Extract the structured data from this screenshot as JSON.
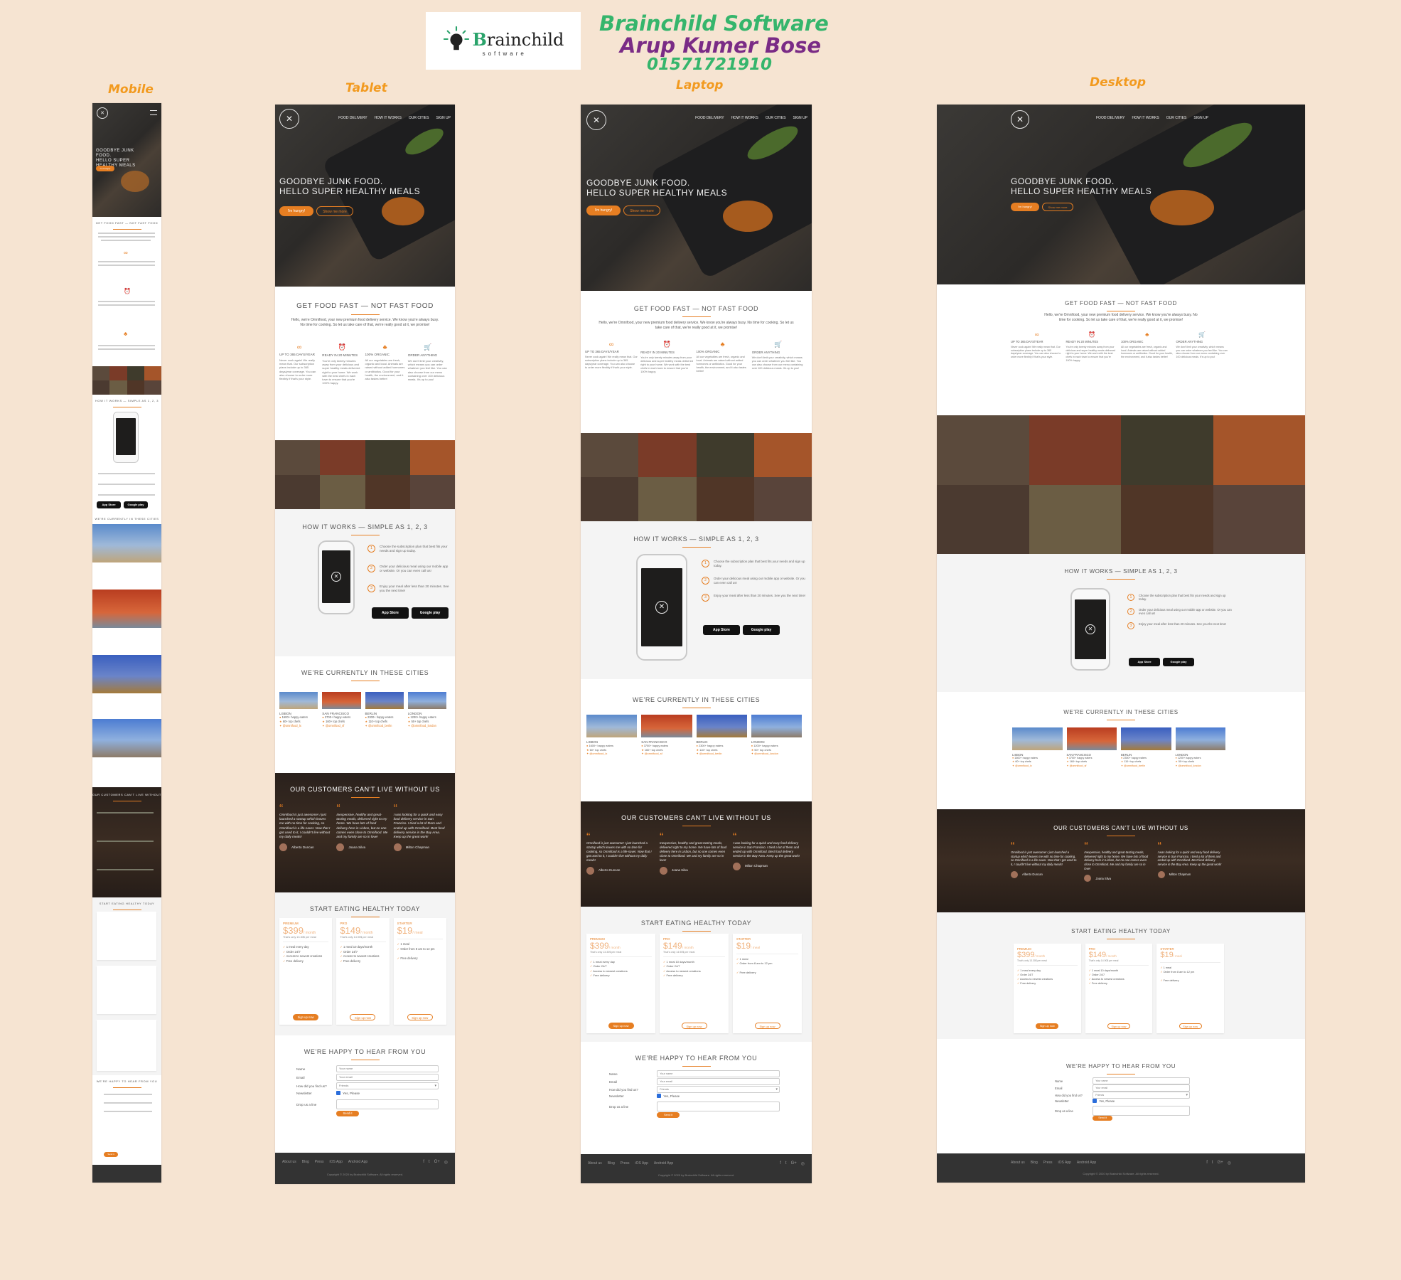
{
  "brand": {
    "logo_word_a": "B",
    "logo_word_b": "rainchild",
    "logo_sub": "software",
    "company": "Brainchild Software",
    "person": "Arup Kumer Bose",
    "phone": "01571721910"
  },
  "labels": {
    "mobile": "Mobile",
    "tablet": "Tablet",
    "laptop": "Laptop",
    "desktop": "Desktop"
  },
  "colors": {
    "accent": "#e67e22",
    "background": "#f6e4d2",
    "brand_green": "#35b56c",
    "brand_purple": "#7a2b86"
  },
  "site": {
    "nav": [
      "Food Delivery",
      "How it works",
      "Our cities",
      "Sign up"
    ],
    "hero_line1": "Goodbye junk food.",
    "hero_line2": "Hello super healthy meals",
    "btn_hungry": "I'm hungry!",
    "btn_more": "Show me more",
    "features_title": "Get food fast — not fast food",
    "features_intro": "Hello, we're Omnifood, your new premium food delivery service. We know you're always busy. No time for cooking. So let us take care of that, we're really good at it, we promise!",
    "features": [
      {
        "icon": "infinity-icon",
        "glyph": "∞",
        "title": "Up to 365 days/year",
        "text": "Never cook again! We really mean that. Our subscription plans include up to 365 days/year coverage. You can also choose to order more flexibly if that's your style."
      },
      {
        "icon": "alarm-icon",
        "glyph": "⏰",
        "title": "Ready in 20 minutes",
        "text": "You're only twenty minutes away from your delicious and super healthy meals delivered right to your home. We work with the best chefs in each town to ensure that you're 100% happy."
      },
      {
        "icon": "carrot-icon",
        "glyph": "♣",
        "title": "100% organic",
        "text": "All our vegetables are fresh, organic and local. Animals are raised without added hormones or antibiotics. Good for your health, the environment, and it also tastes better!"
      },
      {
        "icon": "cart-icon",
        "glyph": "🛒",
        "title": "Order anything",
        "text": "We don't limit your creativity, which means you can order whatever you feel like. You can also choose from our menu containing over 100 delicious meals. It's up to you!"
      }
    ],
    "works_title": "How it works — Simple as 1, 2, 3",
    "steps": [
      {
        "num": "1",
        "text": "Choose the subscription plan that best fits your needs and sign up today."
      },
      {
        "num": "2",
        "text": "Order your delicious meal using our mobile app or website. Or you can even call us!"
      },
      {
        "num": "3",
        "text": "Enjoy your meal after less than 20 minutes. See you the next time!"
      }
    ],
    "app_store": "App Store",
    "google_play": "Google play",
    "cities_title": "We're currently in these cities",
    "cities": [
      {
        "name": "Lisbon",
        "eaters": "1600+ happy eaters",
        "chefs": "60+ top chefs",
        "handle": "@omnifood_lx"
      },
      {
        "name": "San Francisco",
        "eaters": "3700+ happy eaters",
        "chefs": "160+ top chefs",
        "handle": "@omnifood_sf"
      },
      {
        "name": "Berlin",
        "eaters": "2300+ happy eaters",
        "chefs": "110+ top chefs",
        "handle": "@omnifood_berlin"
      },
      {
        "name": "London",
        "eaters": "1200+ happy eaters",
        "chefs": "50+ top chefs",
        "handle": "@omnifood_london"
      }
    ],
    "testimonials_title": "Our customers can't live without us",
    "testimonials": [
      {
        "text": "Omnifood is just awesome! I just launched a startup which leaves me with no time for cooking, so Omnifood is a life-saver. Now that I got used to it, I couldn't live without my daily meals!",
        "name": "Alberto Duncan"
      },
      {
        "text": "Inexpensive, healthy and great-tasting meals, delivered right to my home. We have lots of food delivery here in Lisbon, but no one comes even close to Omnifood. Me and my family are so in love!",
        "name": "Joana Silva"
      },
      {
        "text": "I was looking for a quick and easy food delivery service in San Franciso. I tried a lot of them and ended up with Omnifood. Best food delivery service in the Bay Area. Keep up the great work!",
        "name": "Milton Chapman"
      }
    ],
    "plans_title": "Start eating healthy today",
    "plans": [
      {
        "name": "Premium",
        "price": "$399",
        "per": "/ month",
        "note": "That's only 13.30$ per meal",
        "items": [
          "1 meal every day",
          "Order 24/7",
          "Access to newest creations",
          "Free delivery"
        ],
        "button": "Sign up now"
      },
      {
        "name": "Pro",
        "price": "$149",
        "per": "/ month",
        "note": "That's only 14.90$ per meal",
        "items": [
          "1 meal 10 days/month",
          "Order 24/7",
          "Access to newest creations",
          "Free delivery"
        ],
        "button": "Sign up now"
      },
      {
        "name": "Starter",
        "price": "$19",
        "per": "/ meal",
        "note": "",
        "items": [
          "1 meal",
          "Order from 8 am to 12 pm",
          "",
          "Free delivery"
        ],
        "button": "Sign up now"
      }
    ],
    "form_title": "We're happy to hear from you",
    "form": {
      "name_label": "Name",
      "name_placeholder": "Your name",
      "email_label": "Email",
      "email_placeholder": "Your email",
      "find_label": "How did you find us?",
      "find_value": "Friends",
      "newsletter_label": "Newsletter",
      "newsletter_value": "Yes, Please",
      "message_label": "Drop us a line",
      "submit": "Send it"
    },
    "footer_links": [
      "About us",
      "Blog",
      "Press",
      "iOS App",
      "Android App"
    ],
    "footer_social": [
      "f",
      "t",
      "G+",
      "◎"
    ],
    "copyright": "Copyright © 2020 by Brainchild Software. All rights reserved."
  }
}
